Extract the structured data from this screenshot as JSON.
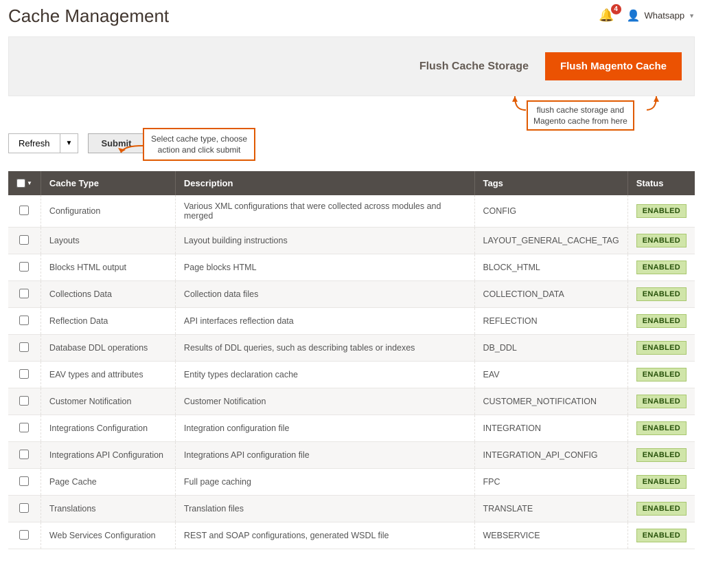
{
  "header": {
    "title": "Cache Management",
    "notification_count": "4",
    "user_name": "Whatsapp"
  },
  "actions": {
    "flush_storage": "Flush Cache Storage",
    "flush_magento": "Flush Magento Cache"
  },
  "annotations": {
    "top_box_line1": "flush cache storage and",
    "top_box_line2": "Magento cache from here",
    "submit_line1": "Select cache type, choose",
    "submit_line2": "action and click submit"
  },
  "toolbar": {
    "refresh_label": "Refresh",
    "submit_label": "Submit"
  },
  "table": {
    "columns": {
      "type": "Cache Type",
      "desc": "Description",
      "tags": "Tags",
      "status": "Status"
    },
    "status_enabled": "ENABLED",
    "rows": [
      {
        "type": "Configuration",
        "desc": "Various XML configurations that were collected across modules and merged",
        "tags": "CONFIG"
      },
      {
        "type": "Layouts",
        "desc": "Layout building instructions",
        "tags": "LAYOUT_GENERAL_CACHE_TAG"
      },
      {
        "type": "Blocks HTML output",
        "desc": "Page blocks HTML",
        "tags": "BLOCK_HTML"
      },
      {
        "type": "Collections Data",
        "desc": "Collection data files",
        "tags": "COLLECTION_DATA"
      },
      {
        "type": "Reflection Data",
        "desc": "API interfaces reflection data",
        "tags": "REFLECTION"
      },
      {
        "type": "Database DDL operations",
        "desc": "Results of DDL queries, such as describing tables or indexes",
        "tags": "DB_DDL"
      },
      {
        "type": "EAV types and attributes",
        "desc": "Entity types declaration cache",
        "tags": "EAV"
      },
      {
        "type": "Customer Notification",
        "desc": "Customer Notification",
        "tags": "CUSTOMER_NOTIFICATION"
      },
      {
        "type": "Integrations Configuration",
        "desc": "Integration configuration file",
        "tags": "INTEGRATION"
      },
      {
        "type": "Integrations API Configuration",
        "desc": "Integrations API configuration file",
        "tags": "INTEGRATION_API_CONFIG"
      },
      {
        "type": "Page Cache",
        "desc": "Full page caching",
        "tags": "FPC"
      },
      {
        "type": "Translations",
        "desc": "Translation files",
        "tags": "TRANSLATE"
      },
      {
        "type": "Web Services Configuration",
        "desc": "REST and SOAP configurations, generated WSDL file",
        "tags": "WEBSERVICE"
      }
    ]
  }
}
